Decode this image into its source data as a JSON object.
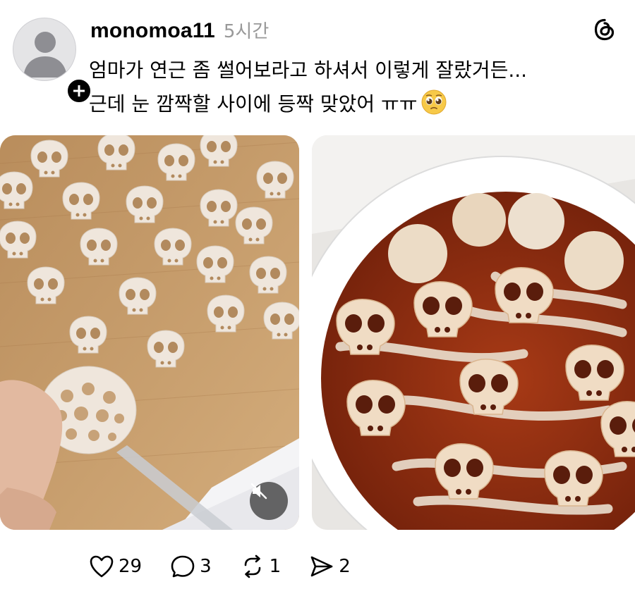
{
  "post": {
    "username": "monomoa11",
    "timestamp": "5시간",
    "caption_lines": [
      "엄마가 연근 좀 썰어보라고 하셔서 이렇게 잘랐거든...",
      "근데 눈 깜짝할 사이에 등짝 맞았어 ㅠㅠ"
    ],
    "caption_emoji": "pleading-face-emoji",
    "media": [
      {
        "kind": "video",
        "description_icon": "video-thumbnail",
        "muted": true
      },
      {
        "kind": "image",
        "description_icon": "photo"
      }
    ],
    "actions": {
      "like_count": "29",
      "reply_count": "3",
      "repost_count": "1",
      "share_count": "2"
    }
  },
  "icons": {
    "logo": "threads-logo-icon",
    "follow": "plus-icon",
    "mute": "speaker-muted-icon",
    "like": "heart-icon",
    "reply": "speech-bubble-icon",
    "repost": "repost-icon",
    "share": "send-icon"
  },
  "colors": {
    "text": "#000000",
    "muted_text": "#999999",
    "avatar_bg": "#e4e4e6",
    "avatar_silhouette": "#8e8e93",
    "badge": "#000000"
  }
}
